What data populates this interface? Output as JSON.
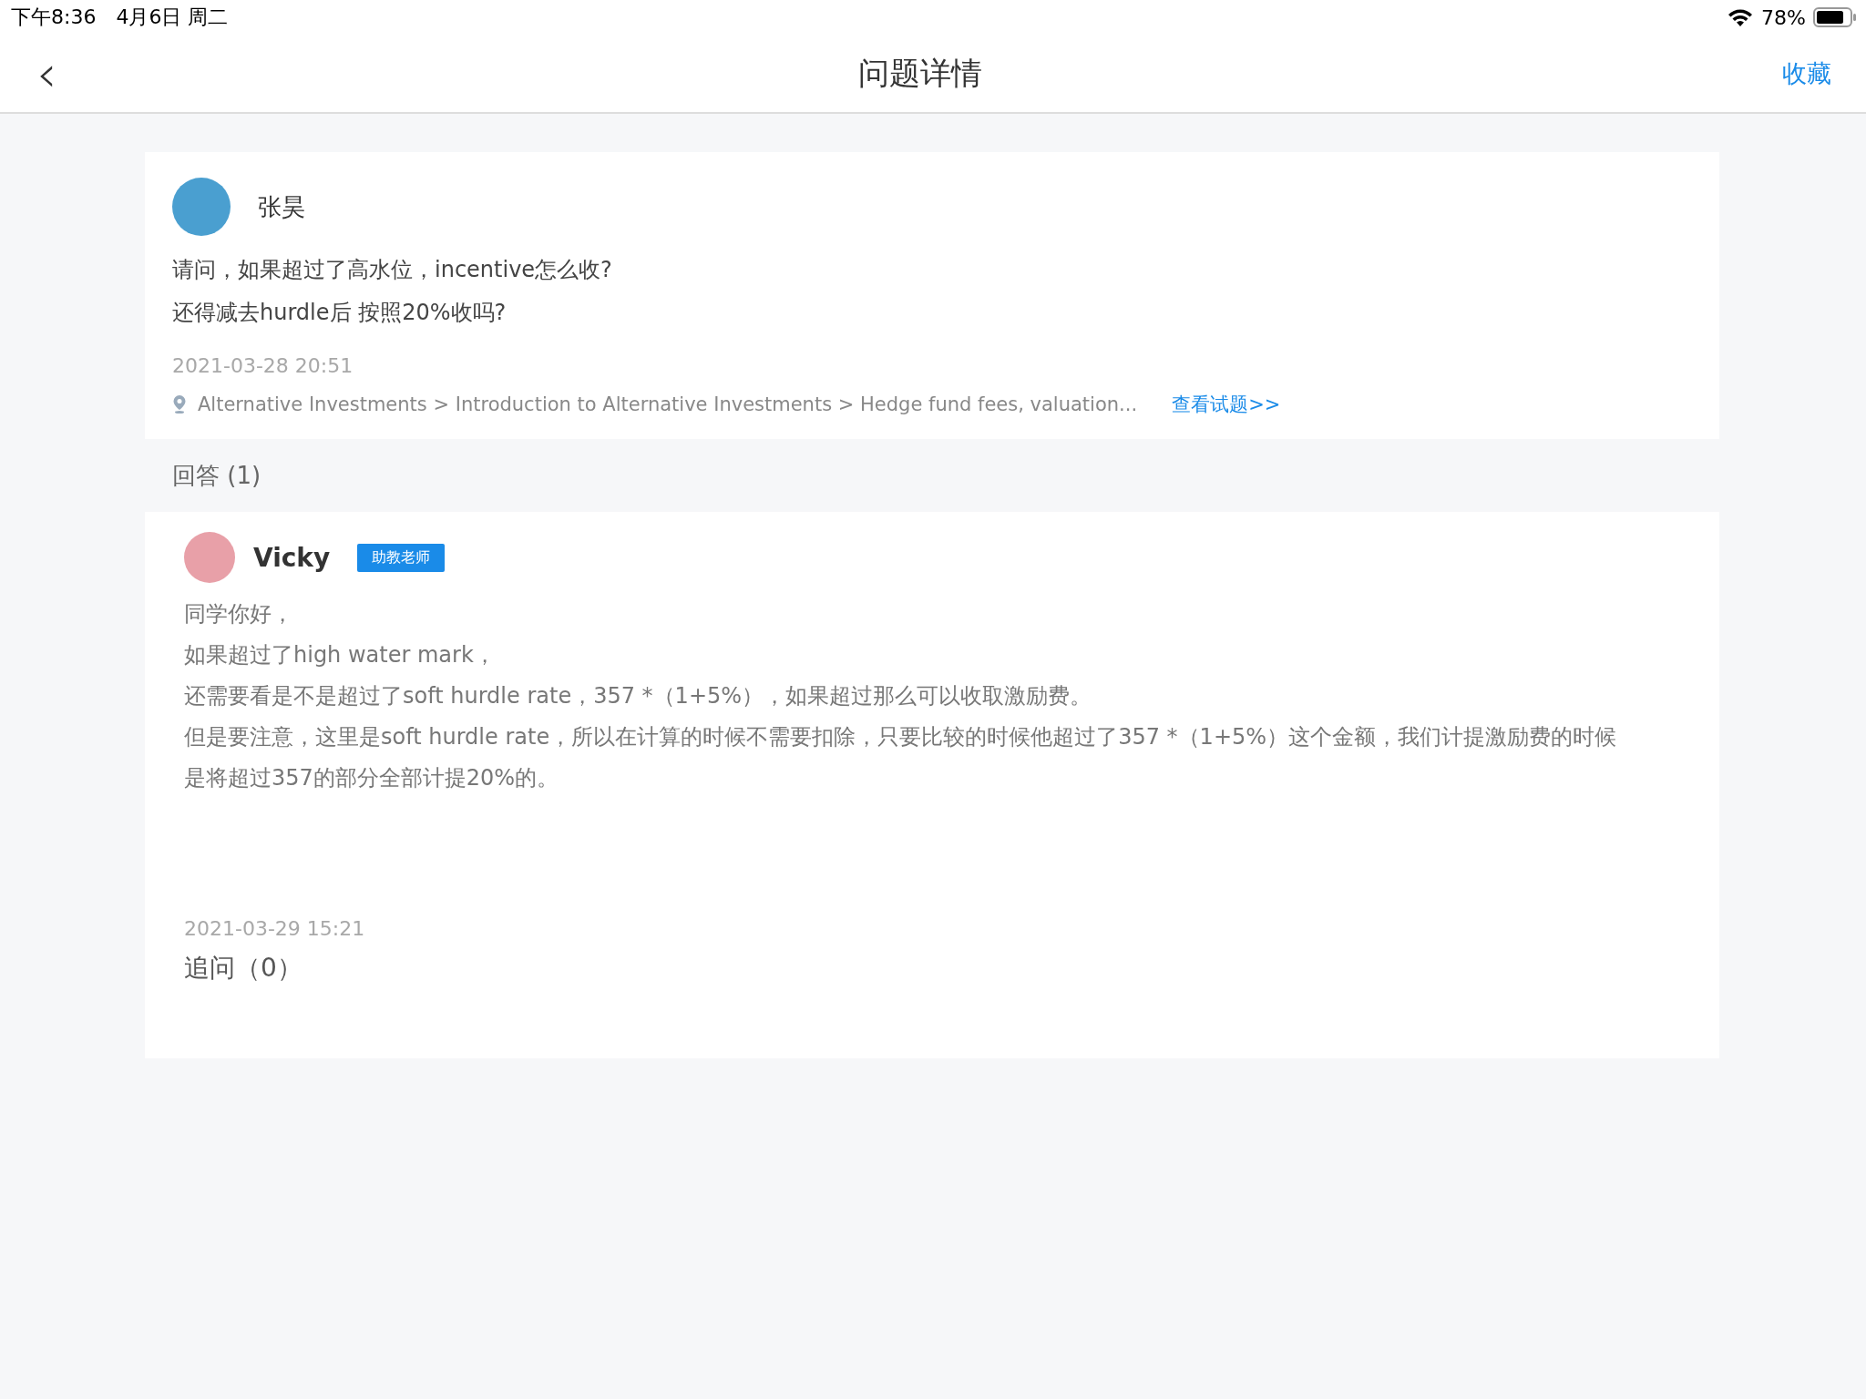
{
  "status_bar": {
    "time": "下午8:36",
    "date": "4月6日 周二",
    "battery": "78%"
  },
  "nav_bar": {
    "back_icon": "‹",
    "title": "问题详情",
    "action": "收藏"
  },
  "question": {
    "author": "张昊",
    "lines": [
      "请问，如果超过了高水位，incentive怎么收?",
      "还得减去hurdle后 按照20%收吗?"
    ],
    "time": "2021-03-28 20:51",
    "breadcrumb": "Alternative Investments > Introduction to Alternative Investments > Hedge fund fees, valuation...",
    "link": "查看试题>>"
  },
  "answers_header": "回答 (1)",
  "answer": {
    "author": "Vicky",
    "badge": "助教老师",
    "paragraphs": [
      "同学你好，",
      "如果超过了high water mark，",
      "还需要看是不是超过了soft hurdle rate，357 *（1+5%），如果超过那么可以收取激励费。",
      "但是要注意，这里是soft hurdle rate，所以在计算的时候不需要扣除，只要比较的时候他超过了357 *（1+5%）这个金额，我们计提激励费的时候是将超过357的部分全部计提20%的。"
    ],
    "time": "2021-03-29 15:21",
    "follow_up": "追问（0）"
  }
}
